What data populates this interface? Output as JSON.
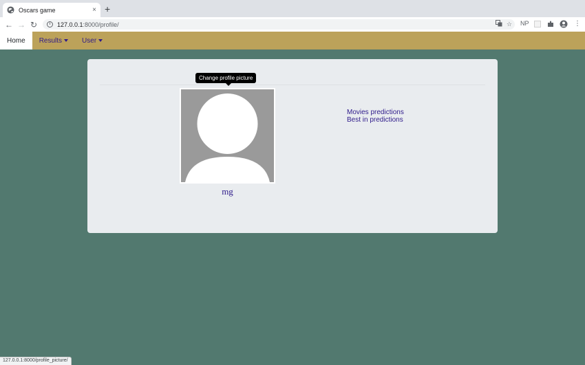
{
  "browser": {
    "tab_title": "Oscars game",
    "tab_close": "×",
    "new_tab": "+",
    "url_host": "127.0.0.1",
    "url_path": ":8000/profile/",
    "profile_ext": "NP"
  },
  "navbar": {
    "home": "Home",
    "results": "Results",
    "user": "User"
  },
  "profile": {
    "tooltip": "Change profile picture",
    "username": "mg",
    "links": [
      "Movies predictions",
      "Best in predictions"
    ]
  },
  "status_bar": {
    "url": "127.0.0.1:8000/profile_picture/"
  },
  "colors": {
    "page_bg": "#52796f",
    "navbar_bg": "#bca25a",
    "card_bg": "#e9ecef",
    "link": "#2e1a8a"
  }
}
